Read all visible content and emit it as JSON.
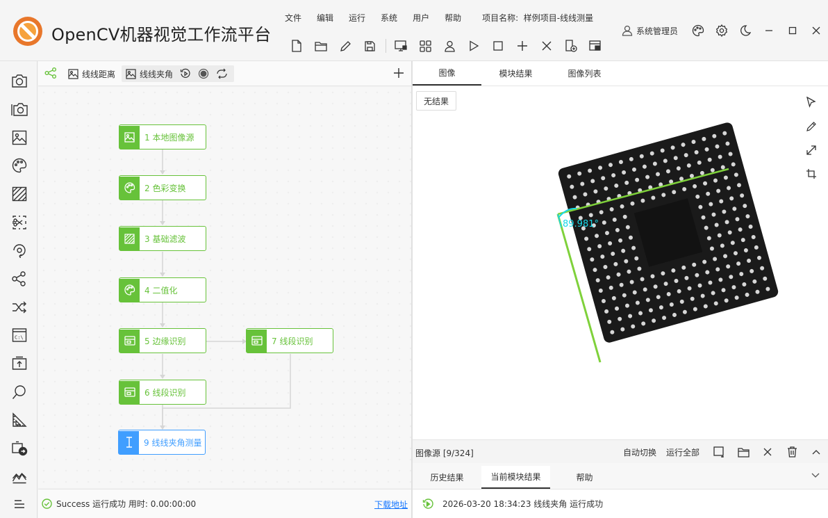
{
  "app": {
    "title": "OpenCV机器视觉工作流平台",
    "menu": [
      "文件",
      "编辑",
      "运行",
      "系统",
      "用户",
      "帮助"
    ],
    "project_label": "项目名称:",
    "project_name": "样例项目-线线测量",
    "user": "系统管理员"
  },
  "toolbar_icons": [
    "new-file-icon",
    "open-folder-icon",
    "edit-icon",
    "save-icon",
    "monitor-icon",
    "grid-icon",
    "user-icon",
    "play-icon",
    "stop-icon",
    "add-icon",
    "close-icon",
    "export-icon",
    "import-icon"
  ],
  "window_icons": [
    "theme-icon",
    "settings-icon",
    "night-mode-icon",
    "minimize-icon",
    "maximize-icon",
    "close-window-icon"
  ],
  "flow": {
    "tabs": [
      {
        "label": "线线距离",
        "icon": "image-icon"
      },
      {
        "label": "线线夹角",
        "icon": "image-icon"
      }
    ],
    "nodes": [
      {
        "id": "1",
        "label": "1 本地图像源",
        "icon": "image-icon",
        "kind": "normal"
      },
      {
        "id": "2",
        "label": "2 色彩变换",
        "icon": "palette-icon",
        "kind": "normal"
      },
      {
        "id": "3",
        "label": "3 基础滤波",
        "icon": "filter-icon",
        "kind": "normal"
      },
      {
        "id": "4",
        "label": "4 二值化",
        "icon": "palette-icon",
        "kind": "normal"
      },
      {
        "id": "5",
        "label": "5 边缘识别",
        "icon": "detector-icon",
        "kind": "normal"
      },
      {
        "id": "7",
        "label": "7 线段识别",
        "icon": "detector-icon",
        "kind": "normal"
      },
      {
        "id": "6",
        "label": "6 线段识别",
        "icon": "detector-icon",
        "kind": "normal"
      },
      {
        "id": "9",
        "label": "9 线线夹角测量",
        "icon": "measure-icon",
        "kind": "selected"
      }
    ],
    "status": "Success 运行成功 用时: 0.00:00:00",
    "download": "下载地址"
  },
  "image_panel": {
    "tabs": [
      "图像",
      "模块结果",
      "图像列表"
    ],
    "active_tab": "图像",
    "no_result": "无结果",
    "angle_text": "89.981°",
    "source": "图像源 [9/324]",
    "auto_switch": "自动切换",
    "run_all": "运行全部"
  },
  "bottom": {
    "tabs": [
      "历史结果",
      "当前模块结果",
      "帮助"
    ],
    "active_tab": "当前模块结果",
    "log": "2026-03-20 18:34:23  线线夹角 运行成功"
  },
  "colors": {
    "accent_green": "#67c23a",
    "accent_blue": "#409eff",
    "angle_cyan": "#18d8e8",
    "link_blue": "#1677ff"
  }
}
